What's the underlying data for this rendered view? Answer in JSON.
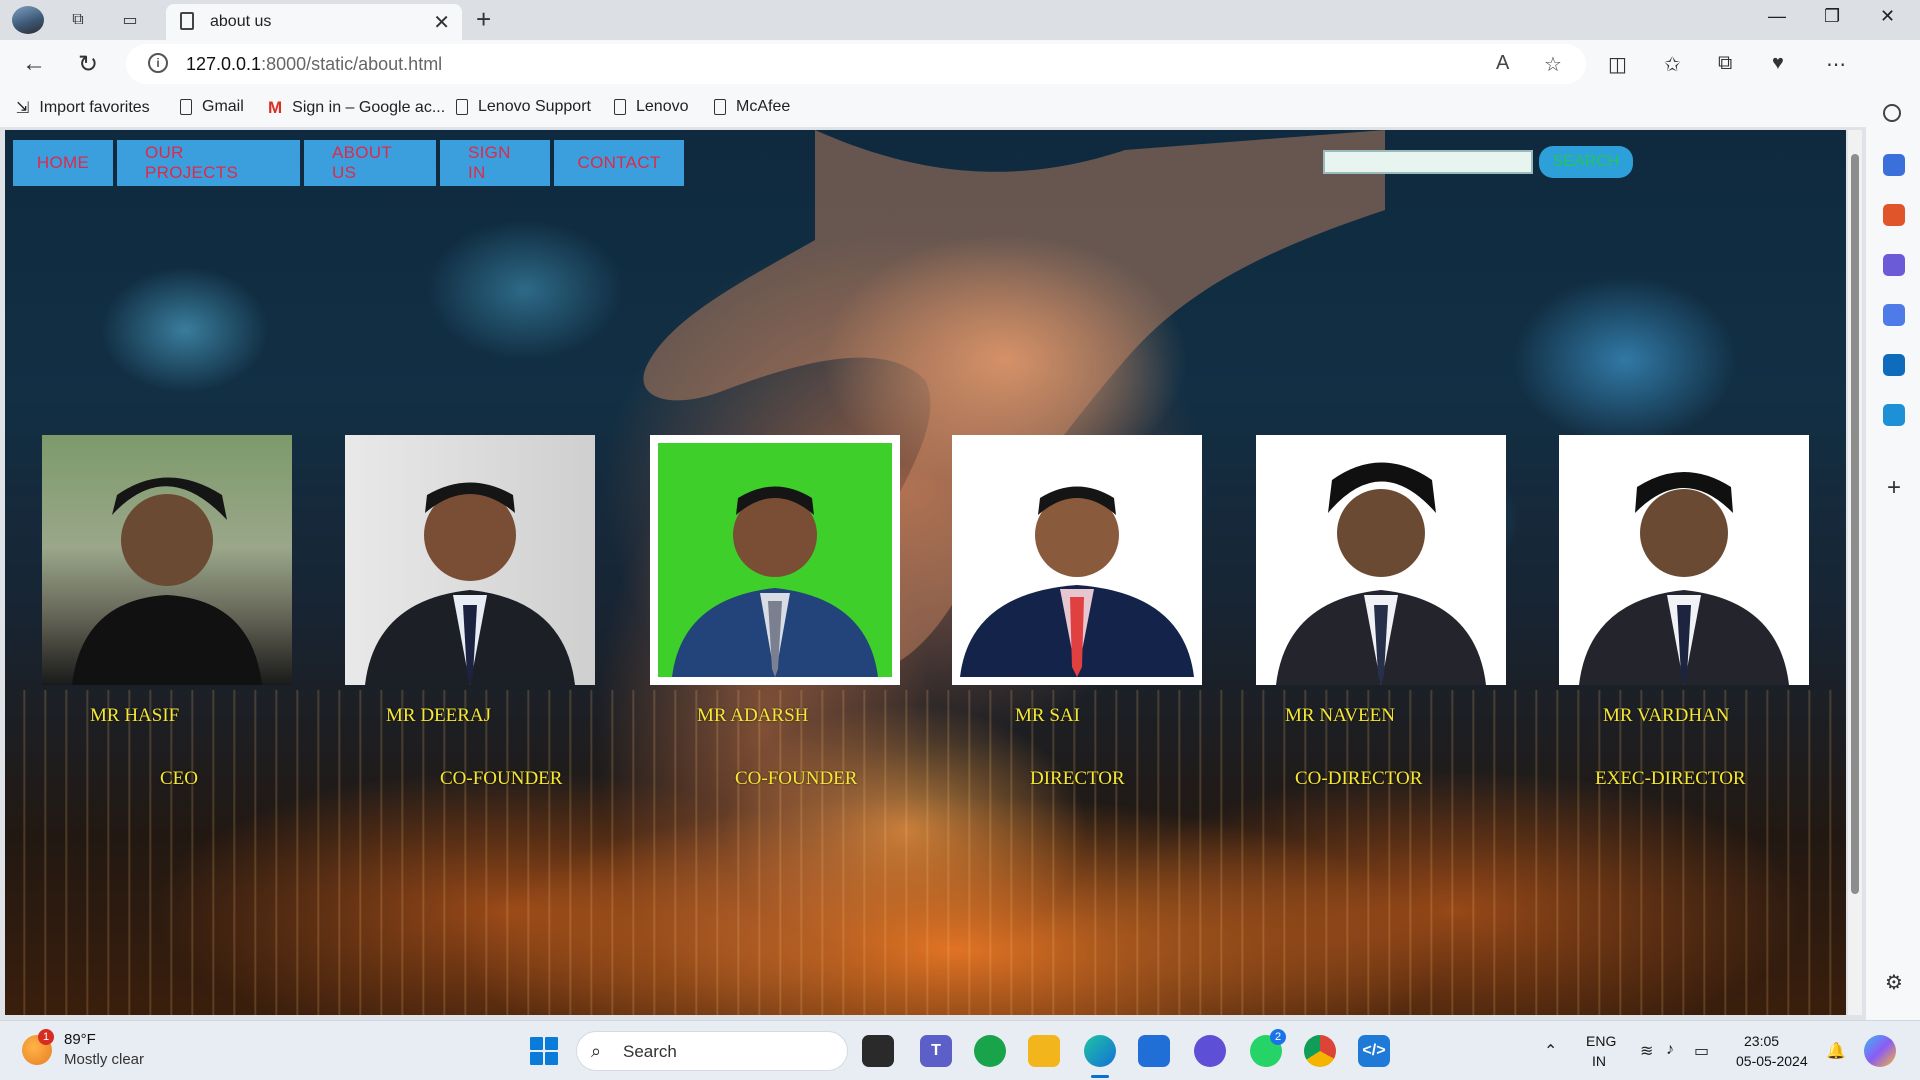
{
  "browser": {
    "tab_title": "about us",
    "url_host": "127.0.0.1",
    "url_rest": ":8000/static/about.html",
    "favorites": [
      "Import favorites",
      "Gmail",
      "Sign in – Google ac...",
      "Lenovo Support",
      "Lenovo",
      "McAfee"
    ]
  },
  "page": {
    "menu": [
      "HOME",
      "OUR PROJECTS",
      "ABOUT US",
      "SIGN IN",
      "CONTACT"
    ],
    "search_button": "SEARCH",
    "search_value": "",
    "team": [
      {
        "name": "MR HASIF",
        "role": "CEO"
      },
      {
        "name": "MR DEERAJ",
        "role": "CO-FOUNDER"
      },
      {
        "name": "MR ADARSH",
        "role": "CO-FOUNDER"
      },
      {
        "name": "MR SAI",
        "role": "DIRECTOR"
      },
      {
        "name": "MR NAVEEN",
        "role": "CO-DIRECTOR"
      },
      {
        "name": "MR VARDHAN",
        "role": "EXEC-DIRECTOR"
      }
    ],
    "colors": {
      "menu_bg": "#3a9fdc",
      "menu_text": "#e0294a",
      "team_text": "#f5e733",
      "search_text": "#22c55e"
    }
  },
  "taskbar": {
    "weather_temp": "89°F",
    "weather_desc": "Mostly clear",
    "weather_badge": "1",
    "search_label": "Search",
    "whatsapp_badge": "2",
    "language": "ENG",
    "region": "IN",
    "time": "23:05",
    "date": "05-05-2024"
  }
}
